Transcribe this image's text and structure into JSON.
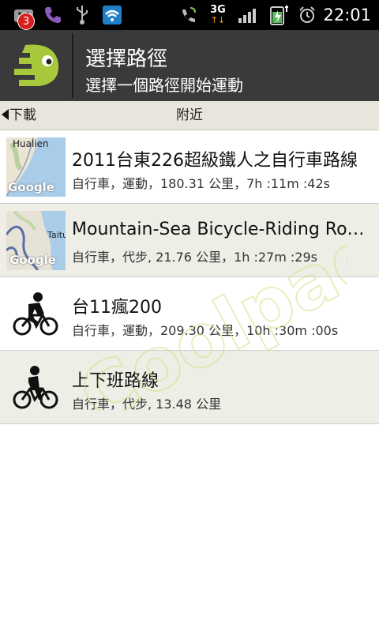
{
  "status_bar": {
    "notification_count": "3",
    "network": "3G",
    "time": "22:01"
  },
  "header": {
    "title": "選擇路徑",
    "subtitle": "選擇一個路徑開始運動"
  },
  "tabs": {
    "left_label": "下載",
    "center_label": "附近"
  },
  "routes": [
    {
      "title": "2011台東226超級鐵人之自行車路線",
      "subtitle": "自行車，運動，180.31 公里，7h :11m :42s",
      "thumb": "map",
      "map_label": "Hualien",
      "map_watermark": "Google"
    },
    {
      "title": "Mountain-Sea Bicycle-Riding Roa...",
      "subtitle": "自行車，代步, 21.76 公里，1h :27m :29s",
      "thumb": "map",
      "map_label": "Taitu",
      "map_watermark": "Google"
    },
    {
      "title": "台11瘋200",
      "subtitle": "自行車，運動，209.30 公里，10h :30m :00s",
      "thumb": "bicycle-icon"
    },
    {
      "title": "上下班路線",
      "subtitle": "自行車，代步, 13.48 公里",
      "thumb": "bicycle-icon"
    }
  ],
  "watermark_text": "Coolpad",
  "colors": {
    "header_bg": "#3a3a3a",
    "logo_green": "#a6c83a",
    "tab_bg": "#e8e6dc",
    "row_alt_bg": "#eeede6",
    "status_bg": "#000000"
  }
}
